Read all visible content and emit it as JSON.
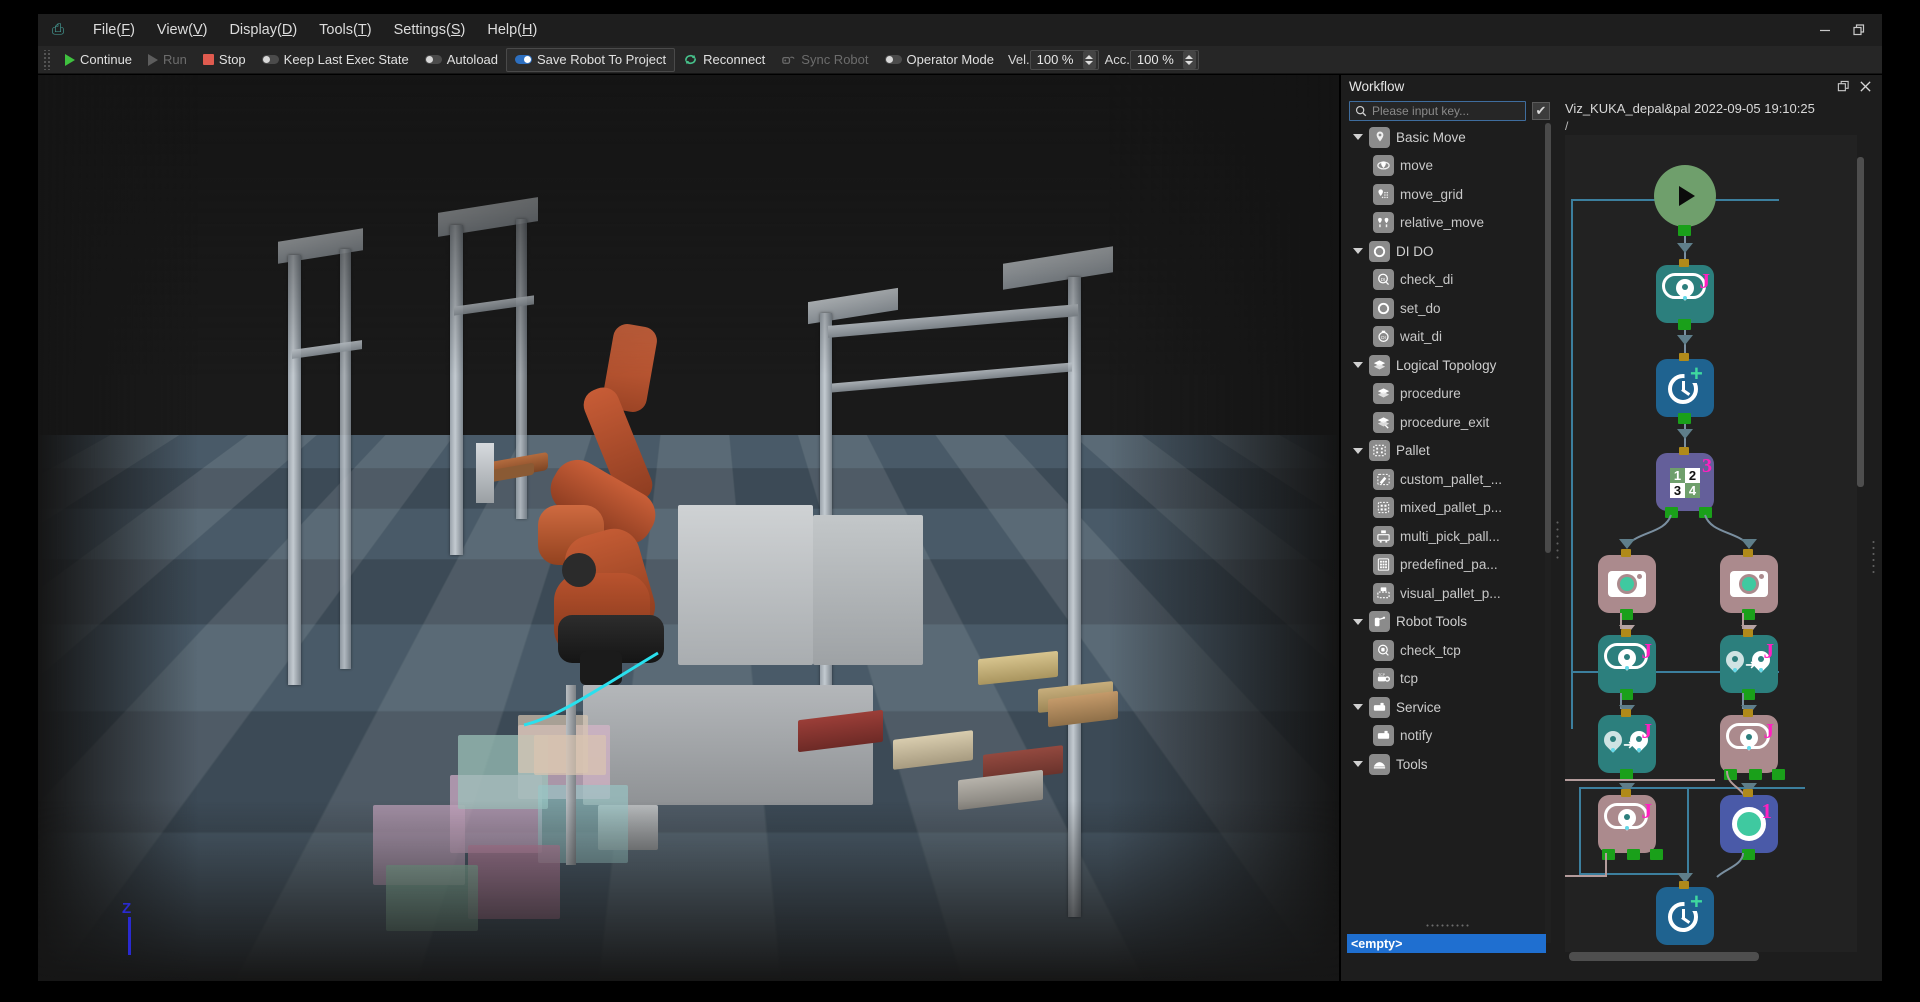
{
  "window": {
    "logo_icon": "app-logo-icon",
    "controls": [
      {
        "name": "minimize-button",
        "glyph": "—"
      },
      {
        "name": "restore-button",
        "glyph": "❐"
      }
    ]
  },
  "menubar": {
    "items": [
      {
        "label": "File",
        "mnemonic": "F"
      },
      {
        "label": "View",
        "mnemonic": "V"
      },
      {
        "label": "Display",
        "mnemonic": "D"
      },
      {
        "label": "Tools",
        "mnemonic": "T"
      },
      {
        "label": "Settings",
        "mnemonic": "S"
      },
      {
        "label": "Help",
        "mnemonic": "H"
      }
    ]
  },
  "toolbar": {
    "continue_label": "Continue",
    "run_label": "Run",
    "stop_label": "Stop",
    "keep_last_exec_label": "Keep Last Exec State",
    "autoload_label": "Autoload",
    "save_robot_label": "Save Robot To Project",
    "reconnect_label": "Reconnect",
    "sync_robot_label": "Sync Robot",
    "operator_mode_label": "Operator Mode",
    "vel_label": "Vel.",
    "vel_value": "100 %",
    "acc_label": "Acc.",
    "acc_value": "100 %",
    "toggles": {
      "keep_last_exec": "off",
      "autoload": "off",
      "save_robot": "on",
      "operator_mode": "off"
    }
  },
  "viewport": {
    "axis_label_z": "Z"
  },
  "dock": {
    "title": "Workflow",
    "float_button": "float-icon",
    "close_button": "close-icon"
  },
  "search": {
    "placeholder": "Please input key...",
    "icon": "search-icon",
    "checkbox_checked": true,
    "check_glyph": "✔"
  },
  "tree": {
    "groups": [
      {
        "label": "Basic Move",
        "icon": "pin-icon",
        "expanded": true,
        "children": [
          {
            "label": "move",
            "icon": "move-icon"
          },
          {
            "label": "move_grid",
            "icon": "move-grid-icon"
          },
          {
            "label": "relative_move",
            "icon": "relative-move-icon"
          }
        ]
      },
      {
        "label": "DI DO",
        "icon": "circle-io-icon",
        "expanded": true,
        "children": [
          {
            "label": "check_di",
            "icon": "check-di-icon"
          },
          {
            "label": "set_do",
            "icon": "set-do-icon"
          },
          {
            "label": "wait_di",
            "icon": "wait-di-icon"
          }
        ]
      },
      {
        "label": "Logical Topology",
        "icon": "layers-icon",
        "expanded": true,
        "children": [
          {
            "label": "procedure",
            "icon": "layers-icon"
          },
          {
            "label": "procedure_exit",
            "icon": "layers-exit-icon"
          }
        ]
      },
      {
        "label": "Pallet",
        "icon": "pallet-icon",
        "expanded": true,
        "children": [
          {
            "label": "custom_pallet_...",
            "icon": "custom-pallet-icon"
          },
          {
            "label": "mixed_pallet_p...",
            "icon": "mixed-pallet-icon"
          },
          {
            "label": "multi_pick_pall...",
            "icon": "multi-pick-pallet-icon"
          },
          {
            "label": "predefined_pa...",
            "icon": "predefined-pallet-icon"
          },
          {
            "label": "visual_pallet_p...",
            "icon": "visual-pallet-icon"
          }
        ]
      },
      {
        "label": "Robot Tools",
        "icon": "robot-tool-icon",
        "expanded": true,
        "children": [
          {
            "label": "check_tcp",
            "icon": "check-tcp-icon"
          },
          {
            "label": "tcp",
            "icon": "tcp-icon"
          }
        ]
      },
      {
        "label": "Service",
        "icon": "service-icon",
        "expanded": true,
        "children": [
          {
            "label": "notify",
            "icon": "notify-icon"
          }
        ]
      },
      {
        "label": "Tools",
        "icon": "tools-icon",
        "expanded": true,
        "children": []
      }
    ],
    "empty_label": "<empty>"
  },
  "workflow": {
    "title": "Viz_KUKA_depal&pal 2022-09-05 19:10:25",
    "path": "/",
    "nodes": [
      {
        "name": "start-node",
        "icon": "play-icon",
        "color": "#6f9f6c"
      },
      {
        "name": "move-node-1",
        "icon": "move-icon",
        "color": "#2c7f7d",
        "badge": "J"
      },
      {
        "name": "wait-node-1",
        "icon": "clock-plus-icon",
        "color": "#1f6390"
      },
      {
        "name": "pallet-node",
        "icon": "grid-1234-icon",
        "color": "#645f9a",
        "badge": "3"
      },
      {
        "name": "camera-node-1",
        "icon": "camera-icon",
        "color": "#ab8a8d"
      },
      {
        "name": "camera-node-2",
        "icon": "camera-icon",
        "color": "#ab8a8d"
      },
      {
        "name": "move-node-2",
        "icon": "move-icon",
        "color": "#2c7f7d",
        "badge": "J"
      },
      {
        "name": "relative-move-node-1",
        "icon": "relative-move-icon",
        "color": "#2c7f7d",
        "badge": "J"
      },
      {
        "name": "relative-move-node-2",
        "icon": "relative-move-icon",
        "color": "#2c7f7d",
        "badge": "J"
      },
      {
        "name": "move-node-3",
        "icon": "move-icon",
        "color": "#ab8a8d",
        "badge": "J"
      },
      {
        "name": "move-node-4",
        "icon": "move-icon",
        "color": "#ab8a8d",
        "badge": "J"
      },
      {
        "name": "set-do-node",
        "icon": "set-do-icon",
        "color": "#4a5aa8",
        "badge": "1"
      },
      {
        "name": "wait-node-2",
        "icon": "clock-plus-icon",
        "color": "#1f6390"
      }
    ]
  },
  "colors": {
    "accent_blue": "#1f6fd0",
    "node_green": "#6f9f6c",
    "node_teal": "#2c7f7d",
    "node_blue": "#1f6390",
    "node_purple": "#645f9a",
    "node_rose": "#ab8a8d",
    "node_indigo": "#4a5aa8",
    "badge_magenta": "#ff20c0",
    "port_green": "#1aa01a"
  }
}
